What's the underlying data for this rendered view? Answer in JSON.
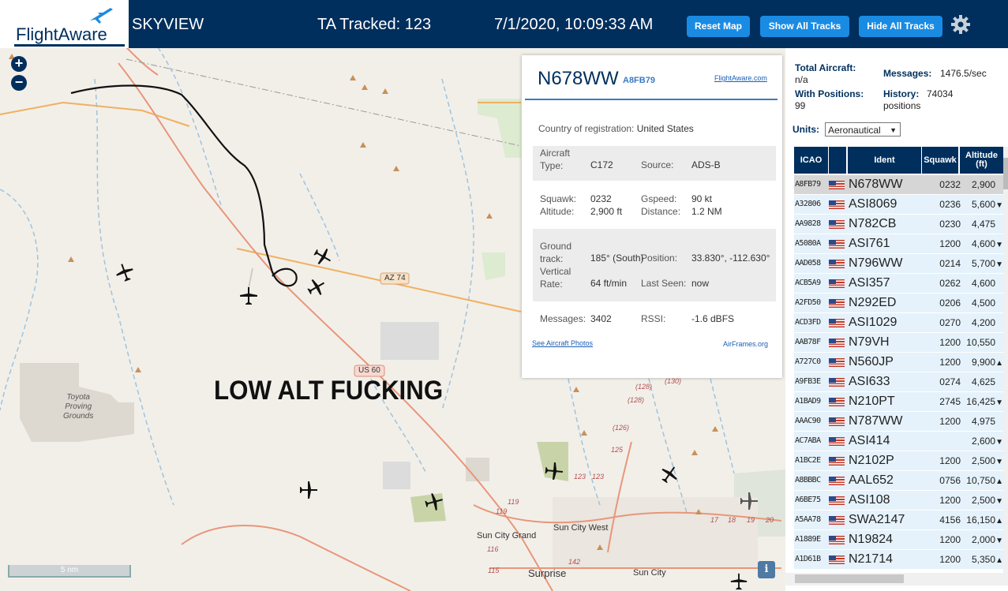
{
  "header": {
    "logo_text": "FlightAware",
    "app_name": "SKYVIEW",
    "tracked": "TA Tracked: 123",
    "datetime": "7/1/2020, 10:09:33 AM",
    "buttons": {
      "reset_map": "Reset Map",
      "show_all_tracks": "Show All Tracks",
      "hide_all_tracks": "Hide All Tracks"
    },
    "settings_icon": "gear-icon"
  },
  "map": {
    "zoom_in": "+",
    "zoom_out": "−",
    "overlay_text": "LOW ALT FUCKING",
    "scale": "5 nm",
    "info": "i",
    "labels": {
      "az74": "AZ 74",
      "us60": "US 60",
      "toyota": [
        "Toyota",
        "Proving",
        "Grounds"
      ],
      "sun_city_west": "Sun City West",
      "sun_city_grand": "Sun City Grand",
      "surprise": "Surprise",
      "sun_city": "Sun City",
      "route_128a": "(128)",
      "route_128b": "(128)",
      "route_130": "(130)",
      "route_126": "(126)",
      "route_125": "125",
      "route_123": "123",
      "route_123b": "123",
      "route_119": "119",
      "route_119b": "119",
      "route_116": "116",
      "route_115": "115",
      "route_142": "142",
      "route_17": "17",
      "route_18": "18",
      "route_19": "19",
      "route_20": "20"
    }
  },
  "popup": {
    "callsign": "N678WW",
    "icao": "A8FB79",
    "fa_link": "FlightAware.com",
    "country_label": "Country of registration:",
    "country_value": "United States",
    "aircraft_type_label_1": "Aircraft",
    "aircraft_type_label_2": "Type:",
    "aircraft_type": "C172",
    "source_label": "Source:",
    "source": "ADS-B",
    "squawk_label": "Squawk:",
    "squawk": "0232",
    "gspeed_label": "Gspeed:",
    "gspeed": "90 kt",
    "altitude_label": "Altitude:",
    "altitude": "2,900 ft",
    "distance_label": "Distance:",
    "distance": "1.2 NM",
    "ground_track_label_1": "Ground",
    "ground_track_label_2": "track:",
    "ground_track": "185° (South)",
    "position_label": "Position:",
    "position": "33.830°, -112.630°",
    "vrate_label_1": "Vertical",
    "vrate_label_2": "Rate:",
    "vrate": "64 ft/min",
    "last_seen_label": "Last Seen:",
    "last_seen": "now",
    "messages_label": "Messages:",
    "messages": "3402",
    "rssi_label": "RSSI:",
    "rssi": "-1.6 dBFS",
    "photos_link": "See Aircraft Photos",
    "airframes_link": "AirFrames.org"
  },
  "sidebar": {
    "total_label": "Total Aircraft:",
    "total_value": "n/a",
    "messages_label": "Messages:",
    "messages_value": "1476.5/sec",
    "with_pos_label": "With Positions:",
    "with_pos_value": "99",
    "history_label": "History:",
    "history_value": "74034",
    "history_unit": "positions",
    "units_label": "Units:",
    "units_value": "Aeronautical",
    "columns": {
      "icao": "ICAO",
      "ident": "Ident",
      "squawk": "Squawk",
      "altitude_1": "Altitude",
      "altitude_2": "(ft)"
    },
    "rows": [
      {
        "icao": "A8FB79",
        "ident": "N678WW",
        "squawk": "0232",
        "alt": "2,900",
        "trend": ""
      },
      {
        "icao": "A32806",
        "ident": "ASI8069",
        "squawk": "0236",
        "alt": "5,600",
        "trend": "▼"
      },
      {
        "icao": "AA9828",
        "ident": "N782CB",
        "squawk": "0230",
        "alt": "4,475",
        "trend": ""
      },
      {
        "icao": "A5080A",
        "ident": "ASI761",
        "squawk": "1200",
        "alt": "4,600",
        "trend": "▼"
      },
      {
        "icao": "AAD058",
        "ident": "N796WW",
        "squawk": "0214",
        "alt": "5,700",
        "trend": "▼"
      },
      {
        "icao": "ACB5A9",
        "ident": "ASI357",
        "squawk": "0262",
        "alt": "4,600",
        "trend": ""
      },
      {
        "icao": "A2FD50",
        "ident": "N292ED",
        "squawk": "0206",
        "alt": "4,500",
        "trend": ""
      },
      {
        "icao": "ACD3FD",
        "ident": "ASI1029",
        "squawk": "0270",
        "alt": "4,200",
        "trend": ""
      },
      {
        "icao": "AAB78F",
        "ident": "N79VH",
        "squawk": "1200",
        "alt": "10,550",
        "trend": ""
      },
      {
        "icao": "A727C0",
        "ident": "N560JP",
        "squawk": "1200",
        "alt": "9,900",
        "trend": "▲"
      },
      {
        "icao": "A9FB3E",
        "ident": "ASI633",
        "squawk": "0274",
        "alt": "4,625",
        "trend": ""
      },
      {
        "icao": "A1BAD9",
        "ident": "N210PT",
        "squawk": "2745",
        "alt": "16,425",
        "trend": "▼"
      },
      {
        "icao": "AAAC90",
        "ident": "N787WW",
        "squawk": "1200",
        "alt": "4,975",
        "trend": ""
      },
      {
        "icao": "AC7ABA",
        "ident": "ASI414",
        "squawk": "",
        "alt": "2,600",
        "trend": "▼"
      },
      {
        "icao": "A1BC2E",
        "ident": "N2102P",
        "squawk": "1200",
        "alt": "2,500",
        "trend": "▼"
      },
      {
        "icao": "A8BBBC",
        "ident": "AAL652",
        "squawk": "0756",
        "alt": "10,750",
        "trend": "▲"
      },
      {
        "icao": "A6BE75",
        "ident": "ASI108",
        "squawk": "1200",
        "alt": "2,500",
        "trend": "▼"
      },
      {
        "icao": "A5AA78",
        "ident": "SWA2147",
        "squawk": "4156",
        "alt": "16,150",
        "trend": "▲"
      },
      {
        "icao": "A1889E",
        "ident": "N19824",
        "squawk": "1200",
        "alt": "2,000",
        "trend": "▼"
      },
      {
        "icao": "A1D61B",
        "ident": "N21714",
        "squawk": "1200",
        "alt": "5,350",
        "trend": "▲"
      }
    ]
  },
  "colors": {
    "header_bg": "#002f5d",
    "button_bg": "#1a8be3",
    "row_bg": "#e5f2fb",
    "selected_row": "#d6d6d6"
  }
}
